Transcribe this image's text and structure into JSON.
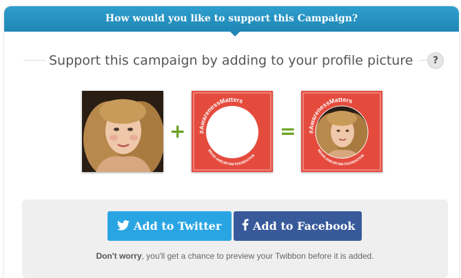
{
  "header": {
    "title": "How would you like to support this Campaign?"
  },
  "subtitle": {
    "text": "Support this campaign by adding to your profile picture",
    "help_label": "?"
  },
  "preview": {
    "plus": "+",
    "equals": "=",
    "frame_hashtag": "#AwarenessMatters",
    "frame_org": "BRAIN ANEURYSM FOUNDATION",
    "frame_color": "#e44b3d"
  },
  "actions": {
    "twitter_label": "Add to Twitter",
    "facebook_label": "Add to Facebook",
    "twitter_icon": "twitter-bird-icon",
    "facebook_icon": "facebook-f-icon",
    "twitter_color": "#2aa5e4",
    "facebook_color": "#385a9b"
  },
  "note": {
    "bold": "Don't worry",
    "rest": ", you'll get a chance to preview your Twibbon before it is added."
  }
}
